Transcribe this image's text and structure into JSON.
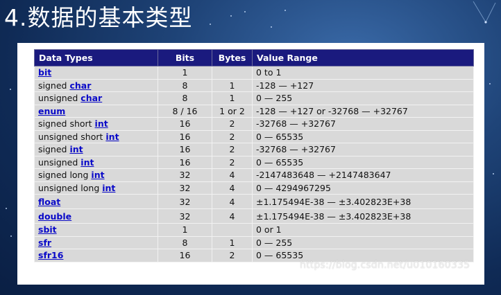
{
  "slide": {
    "title": "4.数据的基本类型"
  },
  "table": {
    "headers": [
      "Data Types",
      "Bits",
      "Bytes",
      "Value Range"
    ],
    "rows": [
      {
        "prefix": "",
        "kw": "bit",
        "suffix": "",
        "bits": "1",
        "bytes": "",
        "range": "0 to 1"
      },
      {
        "prefix": "signed ",
        "kw": "char",
        "suffix": "",
        "bits": "8",
        "bytes": "1",
        "range": "-128 — +127"
      },
      {
        "prefix": "unsigned ",
        "kw": "char",
        "suffix": "",
        "bits": "8",
        "bytes": "1",
        "range": "0 — 255"
      },
      {
        "prefix": "",
        "kw": "enum",
        "suffix": "",
        "bits": "8 / 16",
        "bytes": "1 or 2",
        "range": "-128 — +127 or -32768 — +32767"
      },
      {
        "prefix": "signed short ",
        "kw": "int",
        "suffix": "",
        "bits": "16",
        "bytes": "2",
        "range": "-32768 — +32767"
      },
      {
        "prefix": "unsigned short ",
        "kw": "int",
        "suffix": "",
        "bits": "16",
        "bytes": "2",
        "range": "0 — 65535"
      },
      {
        "prefix": "signed ",
        "kw": "int",
        "suffix": "",
        "bits": "16",
        "bytes": "2",
        "range": "-32768 — +32767"
      },
      {
        "prefix": "unsigned ",
        "kw": "int",
        "suffix": "",
        "bits": "16",
        "bytes": "2",
        "range": "0 — 65535"
      },
      {
        "prefix": "signed long ",
        "kw": "int",
        "suffix": "",
        "bits": "32",
        "bytes": "4",
        "range": "-2147483648 — +2147483647"
      },
      {
        "prefix": "unsigned long ",
        "kw": "int",
        "suffix": "",
        "bits": "32",
        "bytes": "4",
        "range": "0 — 4294967295"
      },
      {
        "prefix": "",
        "kw": "float",
        "suffix": "",
        "bits": "32",
        "bytes": "4",
        "range": "±1.175494E-38 — ±3.402823E+38"
      },
      {
        "prefix": "",
        "kw": "double",
        "suffix": "",
        "bits": "32",
        "bytes": "4",
        "range": "±1.175494E-38 — ±3.402823E+38"
      },
      {
        "prefix": "",
        "kw": "sbit",
        "suffix": "",
        "bits": "1",
        "bytes": "",
        "range": "0 or 1"
      },
      {
        "prefix": "",
        "kw": "sfr",
        "suffix": "",
        "bits": "8",
        "bytes": "1",
        "range": "0 — 255"
      },
      {
        "prefix": "",
        "kw": "sfr16",
        "suffix": "",
        "bits": "16",
        "bytes": "2",
        "range": "0 — 65535"
      }
    ]
  },
  "watermark": "https://blog.csdn.net/u010160335",
  "colors": {
    "header_bg": "#1a1a7e",
    "row_bg": "#d9d9d9",
    "keyword": "#0a0ac8",
    "page_bg": "#1f4478"
  }
}
